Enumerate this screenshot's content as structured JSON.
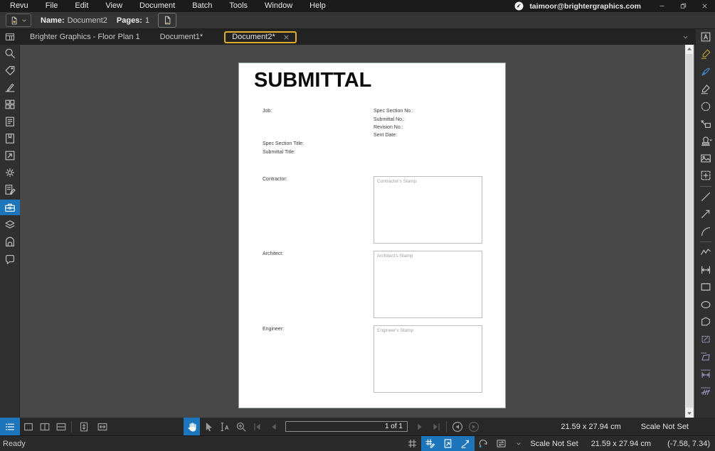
{
  "titlebar": {
    "menus": [
      "Revu",
      "File",
      "Edit",
      "View",
      "Document",
      "Batch",
      "Tools",
      "Window",
      "Help"
    ],
    "user_email": "taimoor@brightergraphics.com"
  },
  "property_bar": {
    "name_label": "Name:",
    "name_value": "Document2",
    "pages_label": "Pages:",
    "pages_value": "1"
  },
  "tab_bar": {
    "tabs": [
      {
        "label": "Brighter Graphics - Floor Plan 1",
        "active": false,
        "closable": false
      },
      {
        "label": "Document1*",
        "active": false,
        "closable": false
      },
      {
        "label": "Document2*",
        "active": true,
        "closable": true
      }
    ]
  },
  "left_panel": {
    "active": "tool-chest",
    "items": [
      "search",
      "properties",
      "signature",
      "thumbnails",
      "bookmarks",
      "file-access",
      "spaces",
      "settings",
      "markup-summary",
      "tool-chest",
      "layers",
      "studio",
      "links"
    ]
  },
  "right_panel": {
    "items": [
      {
        "name": "text-box"
      },
      {
        "name": "highlighter",
        "color": "#b89a30"
      },
      {
        "name": "pen",
        "color": "#3f87c9"
      },
      {
        "name": "eraser"
      },
      {
        "name": "cloud"
      },
      {
        "name": "callout"
      },
      {
        "name": "stamp"
      },
      {
        "name": "image"
      },
      {
        "name": "snapshot"
      },
      {
        "divider": true
      },
      {
        "name": "line"
      },
      {
        "name": "arrow"
      },
      {
        "name": "arc"
      },
      {
        "divider": true
      },
      {
        "name": "polyline"
      },
      {
        "name": "dimension"
      },
      {
        "name": "rectangle"
      },
      {
        "name": "ellipse"
      },
      {
        "name": "polygon"
      },
      {
        "name": "measure-area",
        "color": "#9a90bb"
      },
      {
        "name": "measure-perimeter",
        "color": "#9a90bb"
      },
      {
        "name": "measure-length",
        "color": "#9a90bb"
      },
      {
        "name": "measure-count",
        "color": "#9a90bb"
      }
    ]
  },
  "document": {
    "title": "SUBMITTAL",
    "job_label": "Job:",
    "spec_section_no_label": "Spec Section No.:",
    "submittal_no_label": "Submittal No.:",
    "revision_no_label": "Revision No.:",
    "sent_date_label": "Sent Date:",
    "spec_section_title_label": "Spec Section Title:",
    "submittal_title_label": "Submittal Title:",
    "contractor_label": "Contractor:",
    "contractor_stamp_placeholder": "Contractor's Stamp",
    "architect_label": "Architect:",
    "architect_stamp_placeholder": "Architect's Stamp",
    "engineer_label": "Engineer:",
    "engineer_stamp_placeholder": "Engineer's Stamp"
  },
  "bottom_toolbar": {
    "panel_buttons": [
      {
        "name": "markup-list",
        "active": true
      },
      {
        "name": "single-pane"
      },
      {
        "name": "split-vertical"
      },
      {
        "name": "split-horizontal"
      }
    ],
    "fit_buttons": [
      {
        "name": "fit-page"
      },
      {
        "name": "fit-width"
      }
    ],
    "view_tools": [
      {
        "name": "pan",
        "active": true
      },
      {
        "name": "select"
      },
      {
        "name": "text-select"
      },
      {
        "name": "zoom"
      }
    ],
    "nav_before": [
      {
        "name": "nav-first",
        "disabled": true
      },
      {
        "name": "nav-prev",
        "disabled": true
      }
    ],
    "page_indicator": "1 of 1",
    "nav_after": [
      {
        "name": "nav-next",
        "disabled": true
      },
      {
        "name": "nav-last",
        "disabled": true
      }
    ],
    "view_history": [
      {
        "name": "previous-view"
      },
      {
        "name": "next-view",
        "disabled": true
      }
    ],
    "page_dimensions": "21.59 x 27.94 cm",
    "scale_status": "Scale Not Set"
  },
  "status_bar": {
    "status": "Ready",
    "snap_items": [
      {
        "name": "grid",
        "active": false
      },
      {
        "name": "snap-grid",
        "active": true
      },
      {
        "name": "snap-content",
        "active": true
      },
      {
        "name": "snap-markup",
        "active": true
      },
      {
        "name": "reuse-tool",
        "active": false
      },
      {
        "name": "sync-views",
        "active": false
      }
    ],
    "scale_label": "Scale Not Set",
    "page_dimensions": "21.59 x 27.94 cm",
    "coordinates": "(-7.58, 7.34)"
  },
  "colors": {
    "accent_blue": "#1d76bb",
    "tab_highlight": "#dfae2e",
    "highlighter_yellow": "#b89a30",
    "pen_blue": "#3f87c9",
    "measure_purple": "#9a90bb",
    "canvas_gray": "#484848",
    "page_white": "#ffffff"
  }
}
